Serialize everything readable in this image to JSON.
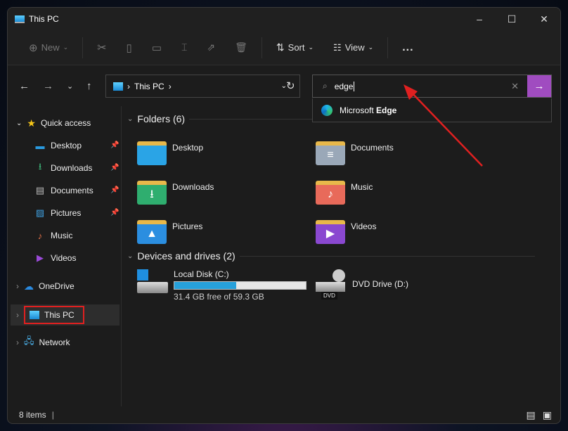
{
  "window": {
    "title": "This PC"
  },
  "toolbar": {
    "new": "New",
    "sort": "Sort",
    "view": "View",
    "more": "..."
  },
  "address": {
    "path": "This PC"
  },
  "search": {
    "value": "edge",
    "suggestion_prefix": "Microsoft ",
    "suggestion_match": "Edge"
  },
  "sidebar": {
    "quick_access": "Quick access",
    "items": [
      {
        "label": "Desktop",
        "pinned": true
      },
      {
        "label": "Downloads",
        "pinned": true
      },
      {
        "label": "Documents",
        "pinned": true
      },
      {
        "label": "Pictures",
        "pinned": true
      },
      {
        "label": "Music",
        "pinned": false
      },
      {
        "label": "Videos",
        "pinned": false
      }
    ],
    "onedrive": "OneDrive",
    "thispc": "This PC",
    "network": "Network"
  },
  "folders": {
    "header": "Folders (6)",
    "items": [
      "Desktop",
      "Documents",
      "Downloads",
      "Music",
      "Pictures",
      "Videos"
    ]
  },
  "drives": {
    "header": "Devices and drives (2)",
    "local": {
      "name": "Local Disk (C:)",
      "free": "31.4 GB free of 59.3 GB",
      "used_percent": 47
    },
    "dvd": {
      "name": "DVD Drive (D:)",
      "badge": "DVD"
    }
  },
  "status": {
    "count": "8 items"
  },
  "colors": {
    "accent": "#a04cc0",
    "highlight_box": "#e02020",
    "arrow": "#e02020",
    "drive_bar": "#26a0da"
  }
}
